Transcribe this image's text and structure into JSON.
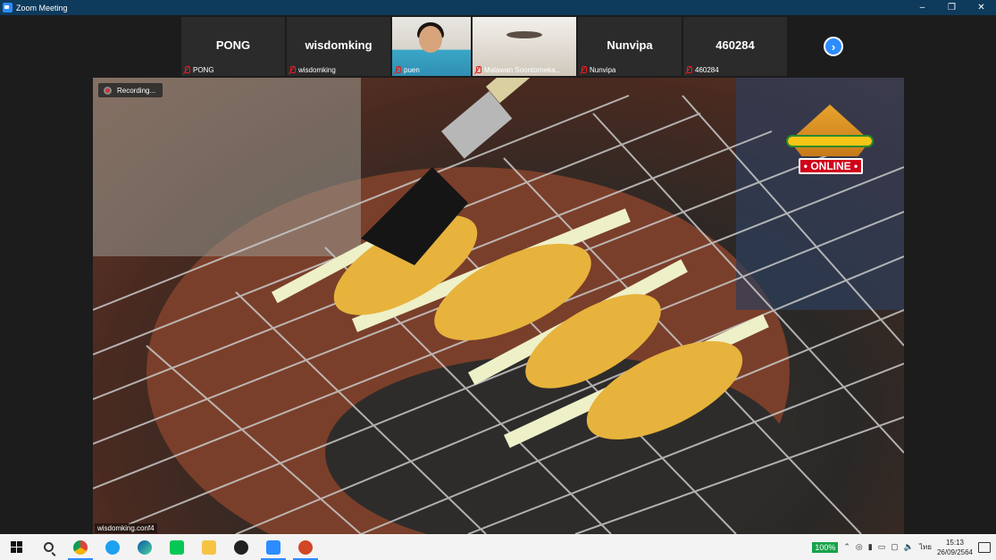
{
  "window": {
    "title": "Zoom Meeting"
  },
  "participants": [
    {
      "display": "PONG",
      "name": "PONG"
    },
    {
      "display": "wisdomking",
      "name": "wisdomking"
    },
    {
      "display": "",
      "name": "puen"
    },
    {
      "display": "",
      "name": "Malawan Soontorneka..."
    },
    {
      "display": "Nunvipa",
      "name": "Nunvipa"
    },
    {
      "display": "460284",
      "name": "460284"
    }
  ],
  "main_video": {
    "recording_label": "Recording...",
    "speaker_name": "wisdomking.conf4",
    "logo_badge": "• ONLINE •"
  },
  "taskbar": {
    "apps": [
      "windows-start",
      "search",
      "chrome",
      "internet-explorer",
      "edge",
      "line",
      "file-explorer",
      "obs",
      "zoom",
      "powerpoint"
    ],
    "battery": "100%",
    "language": "ไทย",
    "time": "15:13",
    "date": "26/09/2564"
  },
  "colors": {
    "titlebar": "#0e3a5c",
    "accent": "#2d8cff",
    "muted_mic": "#e02020"
  }
}
